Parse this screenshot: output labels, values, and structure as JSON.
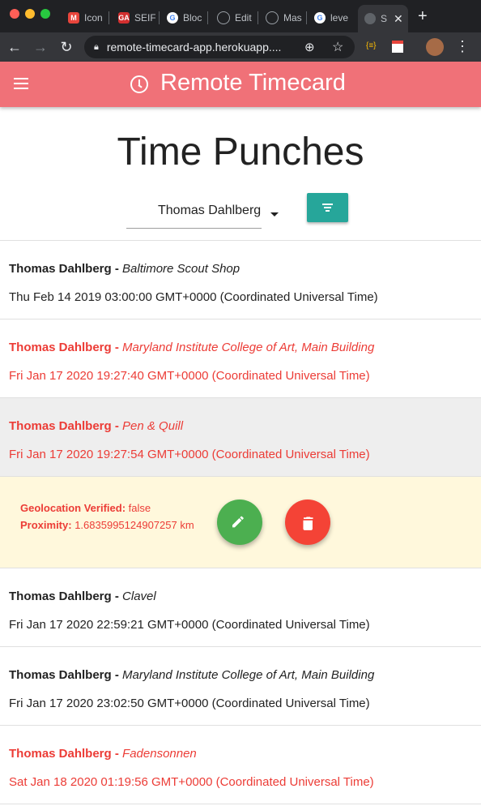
{
  "browser": {
    "tabs": [
      {
        "label": "Icon",
        "color": "#e8453c"
      },
      {
        "label": "SEIF",
        "color": "#d32f2f"
      },
      {
        "label": "Bloc",
        "color": "#9aa0a6"
      },
      {
        "label": "Edit",
        "color": "#202124"
      },
      {
        "label": "Mas",
        "color": "#202124"
      },
      {
        "label": "leve",
        "color": "#4285f4"
      },
      {
        "label": "S",
        "color": "#5f6368"
      }
    ],
    "url": "remote-timecard-app.herokuapp...."
  },
  "app": {
    "title": "Remote Timecard",
    "accent": "#f07178"
  },
  "page": {
    "heading": "Time Punches",
    "employee_select": "Thomas Dahlberg"
  },
  "punches": [
    {
      "name": "Thomas Dahlberg",
      "location": "Baltimore Scout Shop",
      "time": "Thu Feb 14 2019 03:00:00 GMT+0000 (Coordinated Universal Time)",
      "flagged": false
    },
    {
      "name": "Thomas Dahlberg",
      "location": "Maryland Institute College of Art, Main Building",
      "time": "Fri Jan 17 2020 19:27:40 GMT+0000 (Coordinated Universal Time)",
      "flagged": true
    },
    {
      "name": "Thomas Dahlberg",
      "location": "Pen & Quill",
      "time": "Fri Jan 17 2020 19:27:54 GMT+0000 (Coordinated Universal Time)",
      "flagged": true
    },
    {
      "name": "Thomas Dahlberg",
      "location": "Clavel",
      "time": "Fri Jan 17 2020 22:59:21 GMT+0000 (Coordinated Universal Time)",
      "flagged": false
    },
    {
      "name": "Thomas Dahlberg",
      "location": "Maryland Institute College of Art, Main Building",
      "time": "Fri Jan 17 2020 23:02:50 GMT+0000 (Coordinated Universal Time)",
      "flagged": false
    },
    {
      "name": "Thomas Dahlberg",
      "location": "Fadensonnen",
      "time": "Sat Jan 18 2020 01:19:56 GMT+0000 (Coordinated Universal Time)",
      "flagged": true
    }
  ],
  "detail": {
    "geo_label": "Geolocation Verified:",
    "geo_value": "false",
    "prox_label": "Proximity:",
    "prox_value": "1.6835995124907257 km"
  },
  "separator": " - "
}
